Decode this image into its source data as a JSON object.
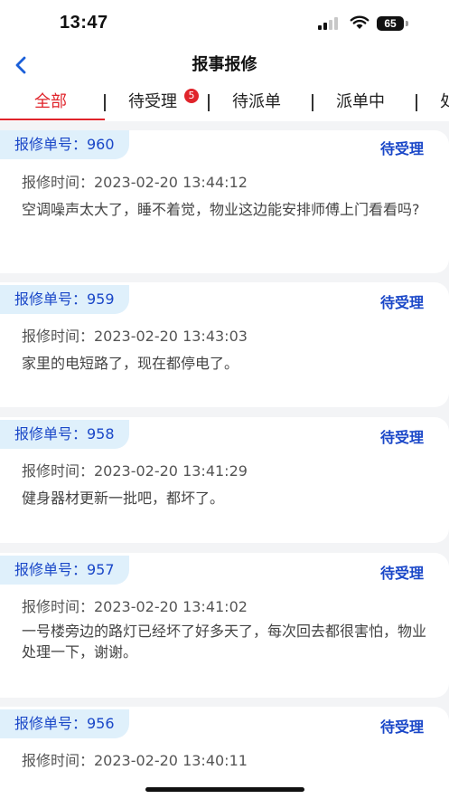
{
  "status_bar": {
    "time": "13:47",
    "battery": "65"
  },
  "nav": {
    "title": "报事报修",
    "back_icon": "chevron-left-icon"
  },
  "tabs": [
    {
      "label": "全部",
      "active": true
    },
    {
      "label": "待受理",
      "badge": "5"
    },
    {
      "label": "待派单"
    },
    {
      "label": "派单中"
    },
    {
      "label": "处"
    }
  ],
  "orders": [
    {
      "number_label": "报修单号：960",
      "status": "待受理",
      "time_label": "报修时间：2023-02-20 13:44:12",
      "description": "空调噪声太大了，睡不着觉，物业这边能安排师傅上门看看吗?"
    },
    {
      "number_label": "报修单号：959",
      "status": "待受理",
      "time_label": "报修时间：2023-02-20 13:43:03",
      "description": "家里的电短路了，现在都停电了。"
    },
    {
      "number_label": "报修单号：958",
      "status": "待受理",
      "time_label": "报修时间：2023-02-20 13:41:29",
      "description": "健身器材更新一批吧，都坏了。"
    },
    {
      "number_label": "报修单号：957",
      "status": "待受理",
      "time_label": "报修时间：2023-02-20 13:41:02",
      "description": "一号楼旁边的路灯已经坏了好多天了，每次回去都很害怕，物业处理一下，谢谢。"
    },
    {
      "number_label": "报修单号：956",
      "status": "待受理",
      "time_label": "报修时间：2023-02-20 13:40:11",
      "description": ""
    }
  ],
  "colors": {
    "accent": "#e0242b",
    "status_blue": "#1a47c8",
    "tag_bg": "#dff0fb",
    "page_bg": "#f3f4f6"
  }
}
